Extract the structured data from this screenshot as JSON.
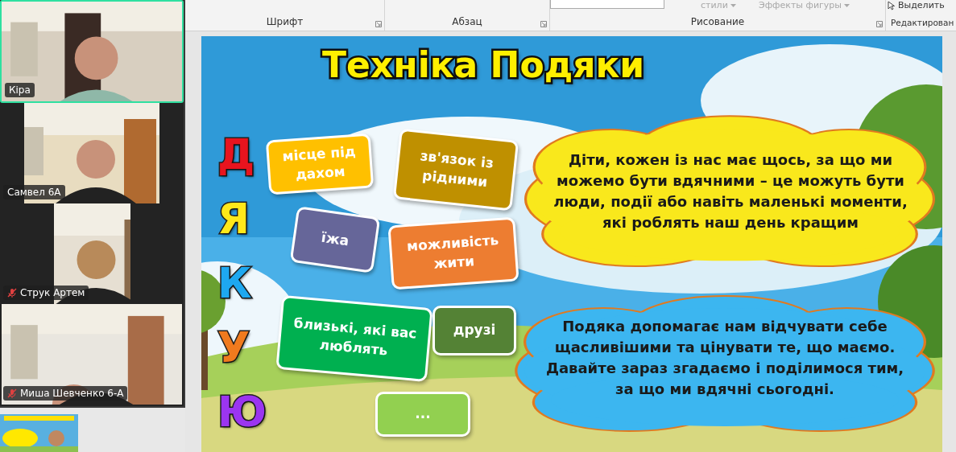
{
  "participants": [
    {
      "name": "Кіра",
      "speaking": true,
      "muted": false,
      "kind": "wide"
    },
    {
      "name": "Самвел 6А",
      "speaking": false,
      "muted": false,
      "kind": "medium"
    },
    {
      "name": "Струк Артем",
      "speaking": false,
      "muted": true,
      "kind": "narrow"
    },
    {
      "name": "Миша Шевченко 6-А",
      "speaking": false,
      "muted": true,
      "kind": "wide"
    }
  ],
  "ribbon": {
    "top_items": [
      {
        "label": "стили",
        "disabled": true
      },
      {
        "label": "Эффекты фигуры",
        "disabled": true
      },
      {
        "label": "Выделить",
        "disabled": false
      }
    ],
    "groups": [
      "Шрифт",
      "Абзац",
      "Рисование",
      "Редактирован"
    ]
  },
  "slide": {
    "title": "Техніка Подяки",
    "acrostic": [
      {
        "letter": "Д",
        "color": "#e8141e"
      },
      {
        "letter": "Я",
        "color": "#ffe81a"
      },
      {
        "letter": "К",
        "color": "#1ea8f0"
      },
      {
        "letter": "У",
        "color": "#f07a1e"
      },
      {
        "letter": "Ю",
        "color": "#9b35f0"
      }
    ],
    "cards": [
      {
        "text": "місце під дахом",
        "color": "#ffc000"
      },
      {
        "text": "зв'язок із рідними",
        "color": "#bf9000"
      },
      {
        "text": "їжа",
        "color": "#666699"
      },
      {
        "text": "можливість жити",
        "color": "#ed7d31"
      },
      {
        "text": "близькі, які вас люблять",
        "color": "#00b050"
      },
      {
        "text": "друзі",
        "color": "#548235"
      },
      {
        "text": "...",
        "color": "#92d050"
      }
    ],
    "notes": [
      {
        "text": "Діти, кожен із нас має щось, за що ми можемо бути вдячними – це можуть бути люди, події або навіть маленькі моменти, які роблять наш день кращим",
        "color": "#f9e81c"
      },
      {
        "text": "Подяка допомагає нам відчувати себе щасливішими та цінувати те, що маємо. Давайте зараз згадаємо і поділимося тим, за що ми вдячні сьогодні.",
        "color": "#3cb6f0"
      }
    ]
  }
}
